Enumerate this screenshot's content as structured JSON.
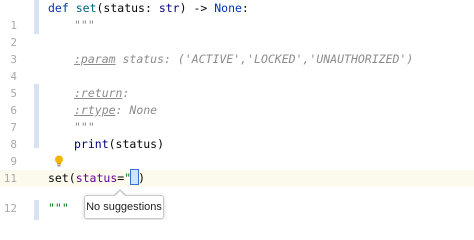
{
  "colors": {
    "keyword": "#0033b3",
    "function": "#00627a",
    "docstring": "#8c8c8c",
    "string": "#067d17",
    "builtin": "#000080",
    "current_line": "#fcfaed",
    "fold_marker": "#d7e3f4"
  },
  "editor": {
    "lines": {
      "l0": {
        "number": "",
        "def": "def",
        "name": "set",
        "open": "(status: ",
        "type": "str",
        "close": ") -> ",
        "none": "None",
        "colon": ":"
      },
      "l1": {
        "number": "1",
        "text": "\"\"\""
      },
      "l2": {
        "number": "2",
        "text": ""
      },
      "l3": {
        "number": "3",
        "tag": ":param",
        "rest": " status: ('ACTIVE','LOCKED','UNAUTHORIZED')"
      },
      "l4": {
        "number": "4",
        "text": ""
      },
      "l5": {
        "number": "5",
        "tag": ":return",
        "rest": ":"
      },
      "l6": {
        "number": "6",
        "tag": ":rtype",
        "rest": ": None"
      },
      "l7": {
        "number": "7",
        "text": "\"\"\""
      },
      "l8": {
        "number": "8",
        "builtin": "print",
        "args": "(status)"
      },
      "l9": {
        "number": "9",
        "text": ""
      },
      "l10": {
        "number": "11",
        "call": "set(",
        "param": "status",
        "eq": "=",
        "quote": "\"",
        "close": ")"
      },
      "l11": {
        "number": "12",
        "text": "\"\"\""
      }
    },
    "intention_icon": "lightbulb-icon"
  },
  "popup": {
    "message": "No suggestions"
  }
}
